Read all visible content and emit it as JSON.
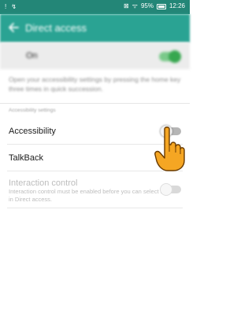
{
  "status_bar": {
    "left_icons": [
      "!",
      "↯"
    ],
    "right_icons": [
      "⊠",
      "ᯤ",
      "▮"
    ],
    "battery_text": "95%",
    "time": "12:26"
  },
  "app_bar": {
    "title": "Direct access"
  },
  "master": {
    "label": "On",
    "state": "on"
  },
  "description": "Open your accessibility settings by pressing the home key three times in quick succession.",
  "section_header": "Accessibility settings",
  "items": [
    {
      "label": "Accessibility",
      "state": "off",
      "enabled": true
    },
    {
      "label": "TalkBack",
      "enabled": true
    },
    {
      "label": "Interaction control",
      "sub": "Interaction control must be enabled before you can select it in Direct access.",
      "state": "off",
      "enabled": false
    }
  ],
  "colors": {
    "status_bar": "#238677",
    "app_bar": "#2aa393",
    "toggle_on": "#37a74f",
    "hand": "#f5a623"
  }
}
